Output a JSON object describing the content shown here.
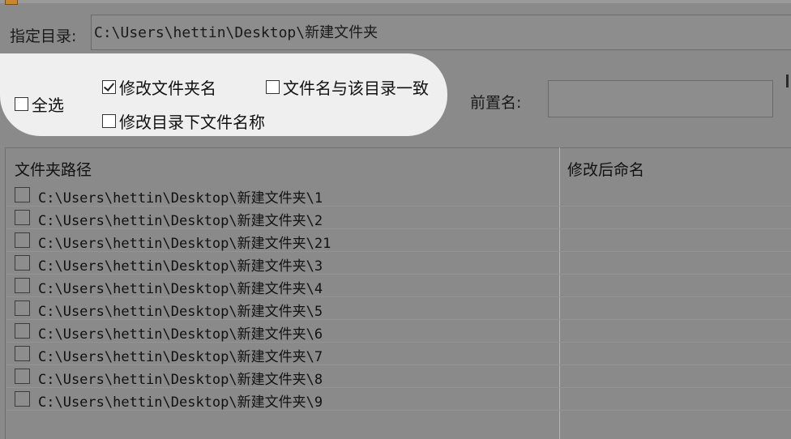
{
  "directory": {
    "label": "指定目录:",
    "value": "C:\\Users\\hettin\\Desktop\\新建文件夹"
  },
  "options": {
    "select_all": {
      "label": "全选",
      "checked": false
    },
    "rename_folder": {
      "label": "修改文件夹名",
      "checked": true
    },
    "filename_match_dir": {
      "label": "文件名与该目录一致",
      "checked": false
    },
    "rename_files_in_dir": {
      "label": "修改目录下文件名称",
      "checked": false
    }
  },
  "prefix": {
    "label": "前置名:",
    "value": ""
  },
  "table": {
    "headers": {
      "path": "文件夹路径",
      "new_name": "修改后命名"
    },
    "rows": [
      {
        "path": "C:\\Users\\hettin\\Desktop\\新建文件夹\\1",
        "new_name": ""
      },
      {
        "path": "C:\\Users\\hettin\\Desktop\\新建文件夹\\2",
        "new_name": ""
      },
      {
        "path": "C:\\Users\\hettin\\Desktop\\新建文件夹\\21",
        "new_name": ""
      },
      {
        "path": "C:\\Users\\hettin\\Desktop\\新建文件夹\\3",
        "new_name": ""
      },
      {
        "path": "C:\\Users\\hettin\\Desktop\\新建文件夹\\4",
        "new_name": ""
      },
      {
        "path": "C:\\Users\\hettin\\Desktop\\新建文件夹\\5",
        "new_name": ""
      },
      {
        "path": "C:\\Users\\hettin\\Desktop\\新建文件夹\\6",
        "new_name": ""
      },
      {
        "path": "C:\\Users\\hettin\\Desktop\\新建文件夹\\7",
        "new_name": ""
      },
      {
        "path": "C:\\Users\\hettin\\Desktop\\新建文件夹\\8",
        "new_name": ""
      },
      {
        "path": "C:\\Users\\hettin\\Desktop\\新建文件夹\\9",
        "new_name": ""
      }
    ]
  }
}
